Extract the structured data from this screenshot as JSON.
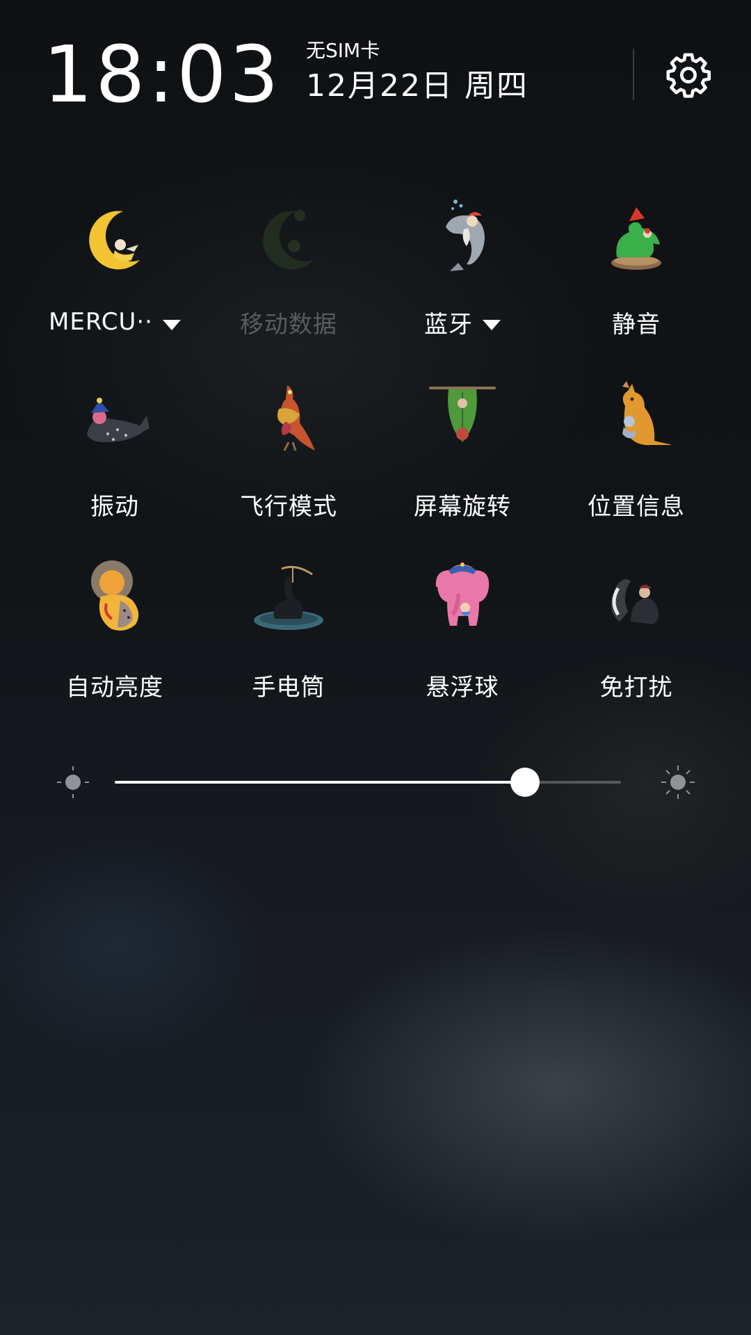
{
  "status": {
    "time": "18:03",
    "sim": "无SIM卡",
    "date": "12月22日 周四"
  },
  "tiles": [
    {
      "label": "MERCU··",
      "icon": "moon-sleeper-icon",
      "dropdown": true,
      "enabled": true
    },
    {
      "label": "移动数据",
      "icon": "mobile-data-icon",
      "dropdown": false,
      "enabled": false
    },
    {
      "label": "蓝牙",
      "icon": "dolphin-icon",
      "dropdown": true,
      "enabled": true
    },
    {
      "label": "静音",
      "icon": "mute-bird-icon",
      "dropdown": false,
      "enabled": true
    },
    {
      "label": "振动",
      "icon": "seal-icon",
      "dropdown": false,
      "enabled": true
    },
    {
      "label": "飞行模式",
      "icon": "parrot-icon",
      "dropdown": false,
      "enabled": true
    },
    {
      "label": "屏幕旋转",
      "icon": "bat-icon",
      "dropdown": false,
      "enabled": true
    },
    {
      "label": "位置信息",
      "icon": "kangaroo-icon",
      "dropdown": false,
      "enabled": true
    },
    {
      "label": "自动亮度",
      "icon": "lion-icon",
      "dropdown": false,
      "enabled": true
    },
    {
      "label": "手电筒",
      "icon": "swan-icon",
      "dropdown": false,
      "enabled": true
    },
    {
      "label": "悬浮球",
      "icon": "elephant-icon",
      "dropdown": false,
      "enabled": true
    },
    {
      "label": "免打扰",
      "icon": "skunk-icon",
      "dropdown": false,
      "enabled": true
    }
  ],
  "brightness": {
    "level": 0.81
  },
  "colors": {
    "accent": "#ffffff",
    "disabled": "#4a4a4a"
  }
}
